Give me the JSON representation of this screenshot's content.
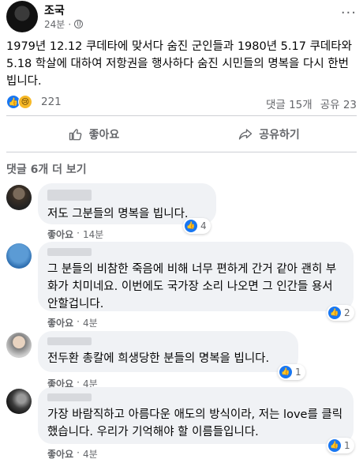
{
  "post": {
    "author": "조국",
    "time": "24분",
    "more": "···",
    "text": "1979년 12.12 쿠데타에 맞서다 숨진 군인들과 1980년 5.17 쿠데타와 5.18 학살에 대하여 저항권을 행사하다 숨진 시민들의 명복을 다시 한번 빕니다."
  },
  "stats": {
    "reaction_count": "221",
    "comments": "댓글 15개",
    "shares": "공유 23"
  },
  "actions": {
    "like_label": "좋아요",
    "share_label": "공유하기"
  },
  "more_comments_label": "댓글 6개 더 보기",
  "comments": [
    {
      "text": "저도 그분들의 명복을 빕니다.",
      "like": "좋아요",
      "time": "14분",
      "likes": "4"
    },
    {
      "text": "그 분들의 비참한 죽음에 비해 너무 편하게 간거 같아 괜히 부화가 치미네요. 이번에도 국가장 소리 나오면 그 인간들 용서 안할겁니다.",
      "like": "좋아요",
      "time": "4분",
      "likes": "2"
    },
    {
      "text": "전두환 총칼에 희생당한 분들의 명복을 빕니다.",
      "like": "좋아요",
      "time": "4분",
      "likes": "1"
    },
    {
      "text": "가장 바람직하고 아름다운 애도의 방식이라, 저는 love를 클릭했습니다. 우리가 기억해야 할 이름들입니다.",
      "like": "좋아요",
      "time": "4분",
      "likes": "1"
    }
  ],
  "colors": {
    "like_blue": "#1877f2",
    "sad_yellow": "#f7b928",
    "bubble_gray": "#f0f2f5",
    "meta_gray": "#65676b"
  }
}
